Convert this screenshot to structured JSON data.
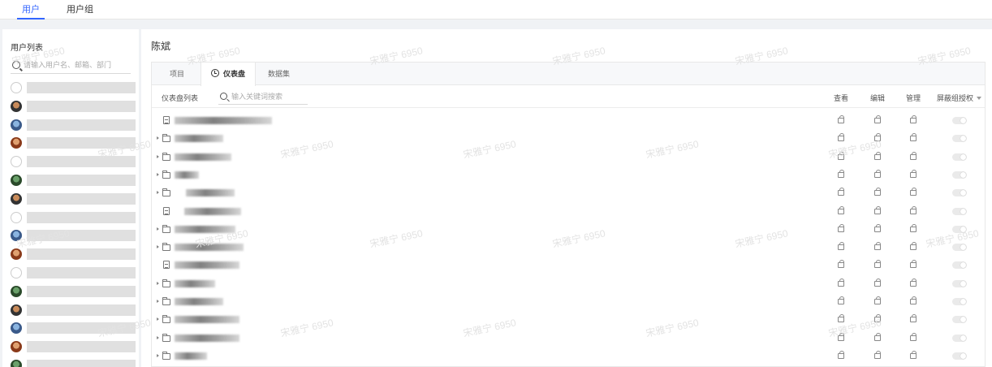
{
  "top_tabs": [
    {
      "label": "用户",
      "active": true
    },
    {
      "label": "用户组",
      "active": false
    }
  ],
  "sidebar": {
    "title": "用户列表",
    "search_placeholder": "请输入用户名、邮箱、部门",
    "users": [
      {
        "avatar": "default-avatar-icon"
      },
      {
        "avatar": "photo-avatar"
      },
      {
        "avatar": "photo-avatar"
      },
      {
        "avatar": "photo-avatar"
      },
      {
        "avatar": "default-avatar-icon"
      },
      {
        "avatar": "photo-avatar"
      },
      {
        "avatar": "photo-avatar"
      },
      {
        "avatar": "default-avatar-icon"
      },
      {
        "avatar": "photo-avatar"
      },
      {
        "avatar": "photo-avatar"
      },
      {
        "avatar": "default-avatar-icon"
      },
      {
        "avatar": "photo-avatar"
      },
      {
        "avatar": "photo-avatar"
      },
      {
        "avatar": "photo-avatar"
      },
      {
        "avatar": "photo-avatar"
      },
      {
        "avatar": "photo-avatar"
      }
    ]
  },
  "main": {
    "user_name": "陈斌",
    "tabs": [
      {
        "label": "项目",
        "active": false
      },
      {
        "label": "仪表盘",
        "active": true,
        "icon": "clock-icon"
      },
      {
        "label": "数据集",
        "active": false
      }
    ],
    "list_label": "仪表盘列表",
    "search_placeholder": "输入关键词搜索",
    "columns": {
      "view": "查看",
      "edit": "编辑",
      "manage": "管理",
      "shield": "屏蔽组授权"
    },
    "rows": [
      {
        "type": "dashboard",
        "expandable": false
      },
      {
        "type": "folder",
        "expandable": true
      },
      {
        "type": "folder",
        "expandable": true
      },
      {
        "type": "folder",
        "expandable": true
      },
      {
        "type": "folder",
        "expandable": true
      },
      {
        "type": "dashboard",
        "expandable": false
      },
      {
        "type": "folder",
        "expandable": true
      },
      {
        "type": "folder",
        "expandable": true
      },
      {
        "type": "dashboard",
        "expandable": false
      },
      {
        "type": "folder",
        "expandable": true
      },
      {
        "type": "folder",
        "expandable": true
      },
      {
        "type": "folder",
        "expandable": true
      },
      {
        "type": "folder",
        "expandable": true
      },
      {
        "type": "folder",
        "expandable": true
      }
    ]
  },
  "watermark": "宋雅宁 6950",
  "colors": {
    "accent": "#3366ff"
  }
}
